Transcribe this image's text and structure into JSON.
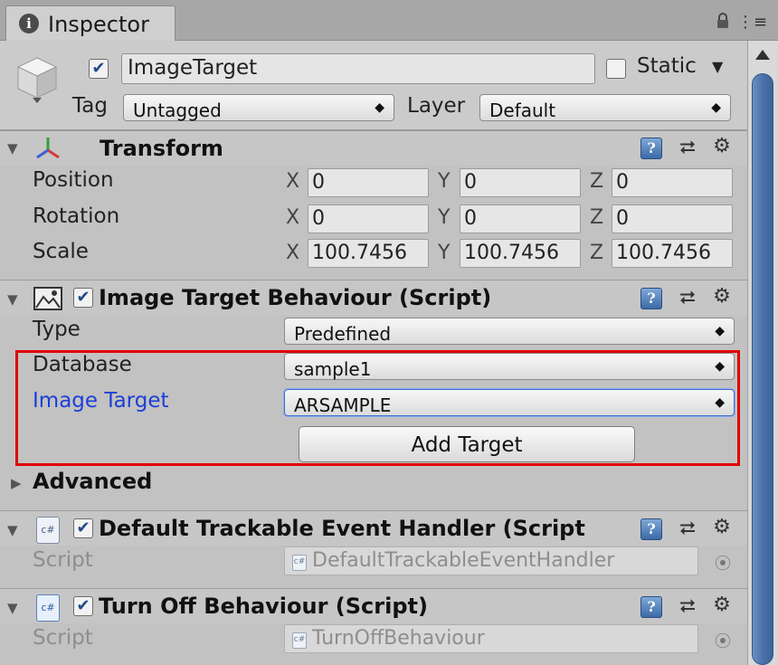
{
  "window": {
    "tab_label": "Inspector",
    "tab_icon_glyph": "i",
    "menu_glyph": "⋮≡"
  },
  "header": {
    "object_name": "ImageTarget",
    "active": true,
    "static_label": "Static",
    "static_checked": false,
    "static_arrow": "▼",
    "tag_label": "Tag",
    "tag_value": "Untagged",
    "layer_label": "Layer",
    "layer_value": "Default"
  },
  "icons": {
    "check": "✔",
    "fold_open": "▼",
    "fold_closed": "▶",
    "help": "?",
    "preset": "⮂",
    "gear": "⚙",
    "select_arrows": "▲\n▼",
    "target": "⦿",
    "cs": "c#"
  },
  "transform": {
    "title": "Transform",
    "rows": [
      {
        "label": "Position",
        "x": "0",
        "y": "0",
        "z": "0"
      },
      {
        "label": "Rotation",
        "x": "0",
        "y": "0",
        "z": "0"
      },
      {
        "label": "Scale",
        "x": "100.7456",
        "y": "100.7456",
        "z": "100.7456"
      }
    ],
    "axis_x": "X",
    "axis_y": "Y",
    "axis_z": "Z"
  },
  "image_target_behaviour": {
    "title": "Image Target Behaviour (Script)",
    "enabled": true,
    "type_label": "Type",
    "type_value": "Predefined",
    "database_label": "Database",
    "database_value": "sample1",
    "image_target_label": "Image Target",
    "image_target_value": "ARSAMPLE",
    "add_target_button": "Add Target",
    "label_color": "#1c3fd6",
    "highlight_color": "#e10000"
  },
  "advanced": {
    "label": "Advanced"
  },
  "default_trackable": {
    "title": "Default Trackable Event Handler (Script",
    "enabled": true,
    "script_label": "Script",
    "script_value": "DefaultTrackableEventHandler"
  },
  "turn_off": {
    "title": "Turn Off Behaviour (Script)",
    "enabled": true,
    "script_label": "Script",
    "script_value": "TurnOffBehaviour"
  }
}
